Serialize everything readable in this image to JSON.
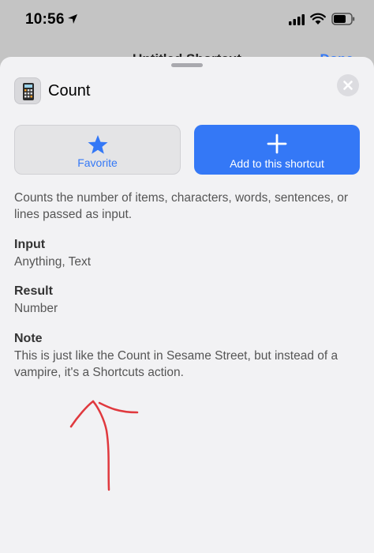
{
  "status_bar": {
    "time": "10:56"
  },
  "underlying_nav": {
    "title": "Untitled Shortcut",
    "done_label": "Done"
  },
  "sheet": {
    "title": "Count",
    "icon": "calculator-icon",
    "favorite_label": "Favorite",
    "add_label": "Add to this shortcut",
    "description": "Counts the number of items, characters, words, sentences, or lines passed as input.",
    "input": {
      "title": "Input",
      "value": "Anything, Text"
    },
    "result": {
      "title": "Result",
      "value": "Number"
    },
    "note": {
      "title": "Note",
      "value": "This is just like the Count in Sesame Street, but instead of a vampire, it's a Shortcuts action."
    }
  },
  "colors": {
    "accent": "#3478f6",
    "annotation": "#e0393e",
    "sheet_bg": "#f2f2f4"
  }
}
